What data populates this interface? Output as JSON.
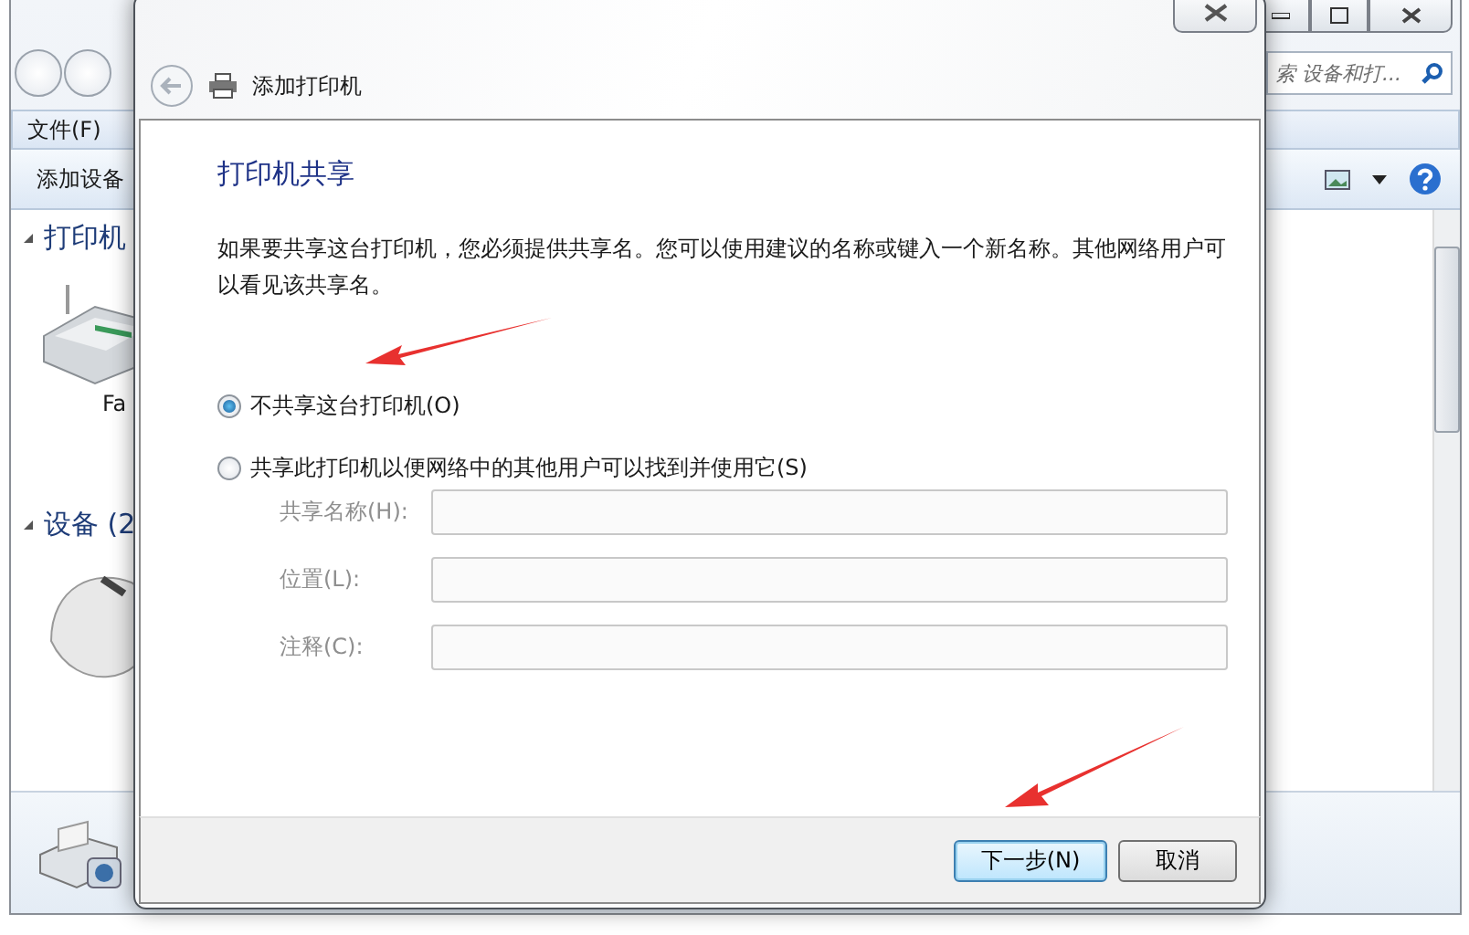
{
  "explorer": {
    "search": {
      "placeholder": "索 设备和打..."
    },
    "menu": [
      "文件(F)"
    ],
    "toolbar": {
      "add_device": "添加设备"
    },
    "groups": [
      {
        "title": "打印机",
        "expanded": true,
        "device_labels": [
          "Fa"
        ]
      },
      {
        "title": "设备 (2",
        "expanded": true
      }
    ]
  },
  "dialog": {
    "title": "添加打印机",
    "heading": "打印机共享",
    "description": "如果要共享这台打印机，您必须提供共享名。您可以使用建议的名称或键入一个新名称。其他网络用户可以看见该共享名。",
    "options": [
      {
        "label": "不共享这台打印机(O)",
        "selected": true
      },
      {
        "label": "共享此打印机以便网络中的其他用户可以找到并使用它(S)",
        "selected": false
      }
    ],
    "fields": [
      {
        "label": "共享名称(H):",
        "disabled": true
      },
      {
        "label": "位置(L):",
        "disabled": true
      },
      {
        "label": "注释(C):",
        "disabled": true
      }
    ],
    "buttons": [
      {
        "label": "下一步(N)",
        "kind": "primary"
      },
      {
        "label": "取消",
        "kind": "normal"
      }
    ]
  }
}
